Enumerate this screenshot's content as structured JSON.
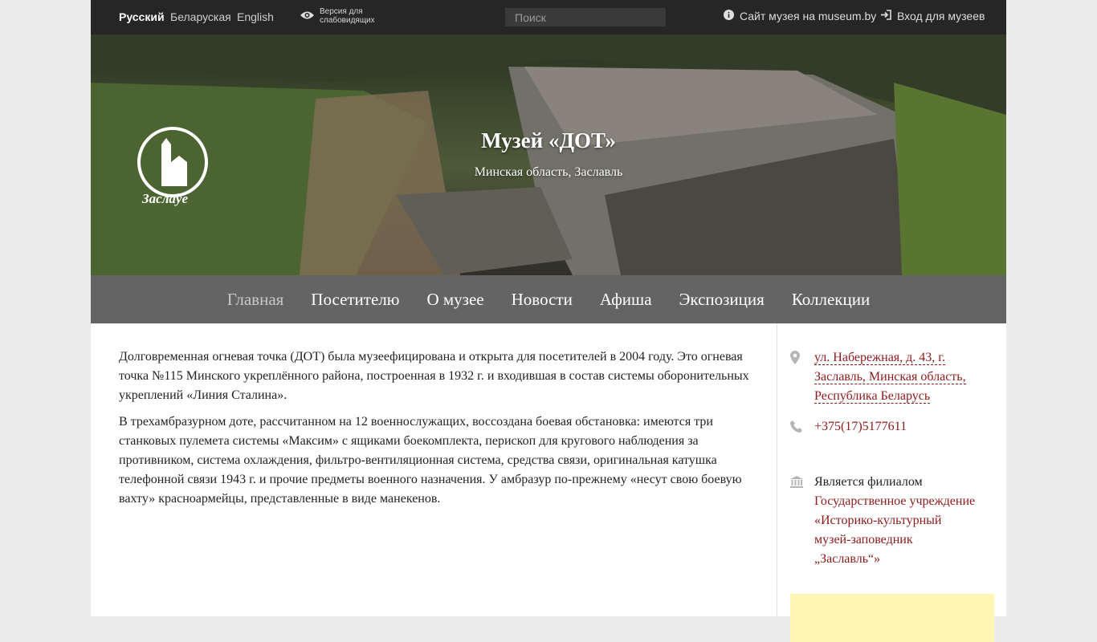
{
  "topbar": {
    "languages": [
      "Русский",
      "Беларуская",
      "English"
    ],
    "low_vision": "Версия для слабовидящих",
    "search_placeholder": "Поиск",
    "museum_site": "Сайт музея на museum.by",
    "login": "Вход для музеев"
  },
  "hero": {
    "title": "Музей «ДОТ»",
    "subtitle": "Минская область, Заславль",
    "logo_text": "Заслаўе"
  },
  "nav": {
    "items": [
      "Главная",
      "Посетителю",
      "О музее",
      "Новости",
      "Афиша",
      "Экспозиция",
      "Коллекции"
    ],
    "active": "Главная"
  },
  "main": {
    "paragraphs": [
      "Долговременная огневая точка (ДОТ) была музеефицирована и открыта для посетителей в 2004 году. Это огневая точка №115 Минского укреплённого района, построенная в 1932 г. и входившая в состав системы оборонительных укреплений «Линия Сталина».",
      "В трехамбразурном доте, рассчитанном на 12 военнослужащих, воссоздана боевая обстановка: имеются три станковых пулемета системы «Максим» с ящиками боекомплекта, перископ для кругового наблюдения за противником, система охлаждения, фильтро-вентиляционная система, средства связи, оригинальная катушка телефонной связи 1943 г. и прочие предметы военного назначения. У амбразур по-прежнему «несут свою боевую вахту» красноармейцы, представленные в виде манекенов."
    ]
  },
  "sidebar": {
    "address_lines": [
      "ул. Набережная, д. 43, г.",
      "Заславль, Минская область,",
      "Республика Беларусь"
    ],
    "phone": "+375(17)5177611",
    "branch_label": "Является филиалом",
    "branch_lines": [
      "Государственное учреждение",
      "«Историко-культурный",
      "музей-заповедник",
      "„Заславль“»"
    ]
  },
  "colors": {
    "topbar_bg": "#262626",
    "nav_bg": "#646464",
    "link": "#8b1a1a",
    "notice_bg": "#fff6b3"
  }
}
